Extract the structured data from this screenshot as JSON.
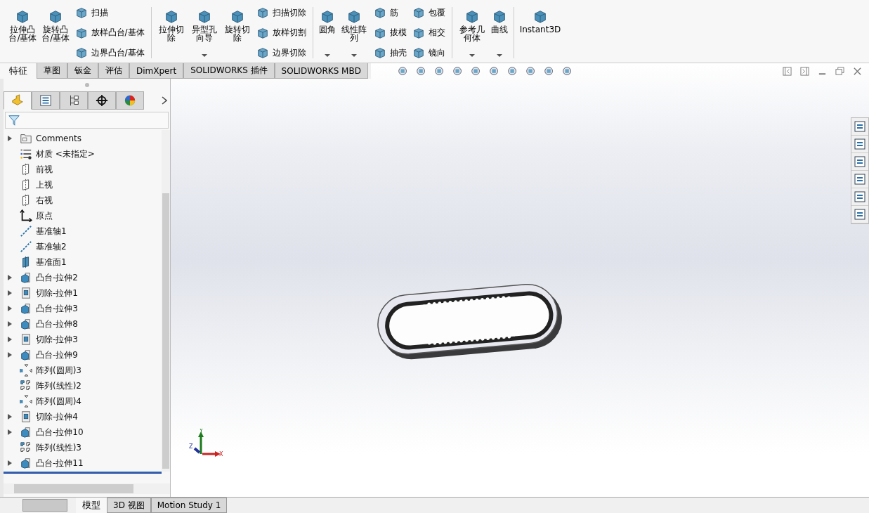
{
  "ribbon": {
    "groups": [
      {
        "items": [
          {
            "kind": "large",
            "label": "拉伸凸台/基体",
            "dropdown": false
          },
          {
            "kind": "large",
            "label": "旋转凸台/基体",
            "dropdown": false
          },
          {
            "kind": "stack",
            "commands": [
              "扫描",
              "放样凸台/基体",
              "边界凸台/基体"
            ]
          }
        ]
      },
      {
        "items": [
          {
            "kind": "large",
            "label": "拉伸切除",
            "dropdown": false
          },
          {
            "kind": "large",
            "label": "异型孔向导",
            "dropdown": true
          },
          {
            "kind": "large",
            "label": "旋转切除",
            "dropdown": false
          },
          {
            "kind": "stack",
            "commands": [
              "扫描切除",
              "放样切割",
              "边界切除"
            ]
          }
        ]
      },
      {
        "items": [
          {
            "kind": "large",
            "label": "圆角",
            "dropdown": true
          },
          {
            "kind": "large",
            "label": "线性阵列",
            "dropdown": true
          },
          {
            "kind": "stack",
            "commands": [
              "筋",
              "拔模",
              "抽壳"
            ]
          },
          {
            "kind": "stack",
            "commands": [
              "包覆",
              "相交",
              "镜向"
            ]
          }
        ]
      },
      {
        "items": [
          {
            "kind": "large",
            "label": "参考几何体",
            "dropdown": true
          },
          {
            "kind": "large",
            "label": "曲线",
            "dropdown": true
          }
        ]
      },
      {
        "items": [
          {
            "kind": "large",
            "label": "Instant3D",
            "dropdown": false
          }
        ]
      }
    ]
  },
  "command_tabs": [
    {
      "label": "特征",
      "selected": true
    },
    {
      "label": "草图",
      "selected": false
    },
    {
      "label": "钣金",
      "selected": false
    },
    {
      "label": "评估",
      "selected": false
    },
    {
      "label": "DimXpert",
      "selected": false
    },
    {
      "label": "SOLIDWORKS 插件",
      "selected": false
    },
    {
      "label": "SOLIDWORKS MBD",
      "selected": false
    }
  ],
  "panel_tabs": [
    {
      "kind": "feature-manager",
      "selected": true
    },
    {
      "kind": "property-manager",
      "selected": false
    },
    {
      "kind": "configuration-manager",
      "selected": false
    },
    {
      "kind": "dimxpert-manager",
      "selected": false
    },
    {
      "kind": "display-manager",
      "selected": false
    }
  ],
  "feature_tree": [
    {
      "kind": "folder",
      "label": "Comments",
      "expandable": true
    },
    {
      "kind": "material",
      "label": "材质 <未指定>",
      "expandable": false
    },
    {
      "kind": "plane",
      "label": "前视",
      "expandable": false
    },
    {
      "kind": "plane",
      "label": "上视",
      "expandable": false
    },
    {
      "kind": "plane",
      "label": "右视",
      "expandable": false
    },
    {
      "kind": "origin",
      "label": "原点",
      "expandable": false
    },
    {
      "kind": "axis",
      "label": "基准轴1",
      "expandable": false
    },
    {
      "kind": "axis",
      "label": "基准轴2",
      "expandable": false
    },
    {
      "kind": "datum-plane",
      "label": "基准面1",
      "expandable": false
    },
    {
      "kind": "boss",
      "label": "凸台-拉伸2",
      "expandable": true
    },
    {
      "kind": "cut",
      "label": "切除-拉伸1",
      "expandable": true
    },
    {
      "kind": "boss",
      "label": "凸台-拉伸3",
      "expandable": true
    },
    {
      "kind": "boss",
      "label": "凸台-拉伸8",
      "expandable": true
    },
    {
      "kind": "cut",
      "label": "切除-拉伸3",
      "expandable": true
    },
    {
      "kind": "boss",
      "label": "凸台-拉伸9",
      "expandable": true
    },
    {
      "kind": "circular-pattern",
      "label": "阵列(圆周)3",
      "expandable": false
    },
    {
      "kind": "linear-pattern",
      "label": "阵列(线性)2",
      "expandable": false
    },
    {
      "kind": "circular-pattern",
      "label": "阵列(圆周)4",
      "expandable": false
    },
    {
      "kind": "cut",
      "label": "切除-拉伸4",
      "expandable": true
    },
    {
      "kind": "boss",
      "label": "凸台-拉伸10",
      "expandable": true
    },
    {
      "kind": "linear-pattern",
      "label": "阵列(线性)3",
      "expandable": false
    },
    {
      "kind": "boss",
      "label": "凸台-拉伸11",
      "expandable": true
    }
  ],
  "triad": {
    "x": "X",
    "y": "Y",
    "z": "Z"
  },
  "bottom_tabs": [
    {
      "label": "模型",
      "selected": true
    },
    {
      "label": "3D 视图",
      "selected": false
    },
    {
      "label": "Motion Study 1",
      "selected": false
    }
  ]
}
